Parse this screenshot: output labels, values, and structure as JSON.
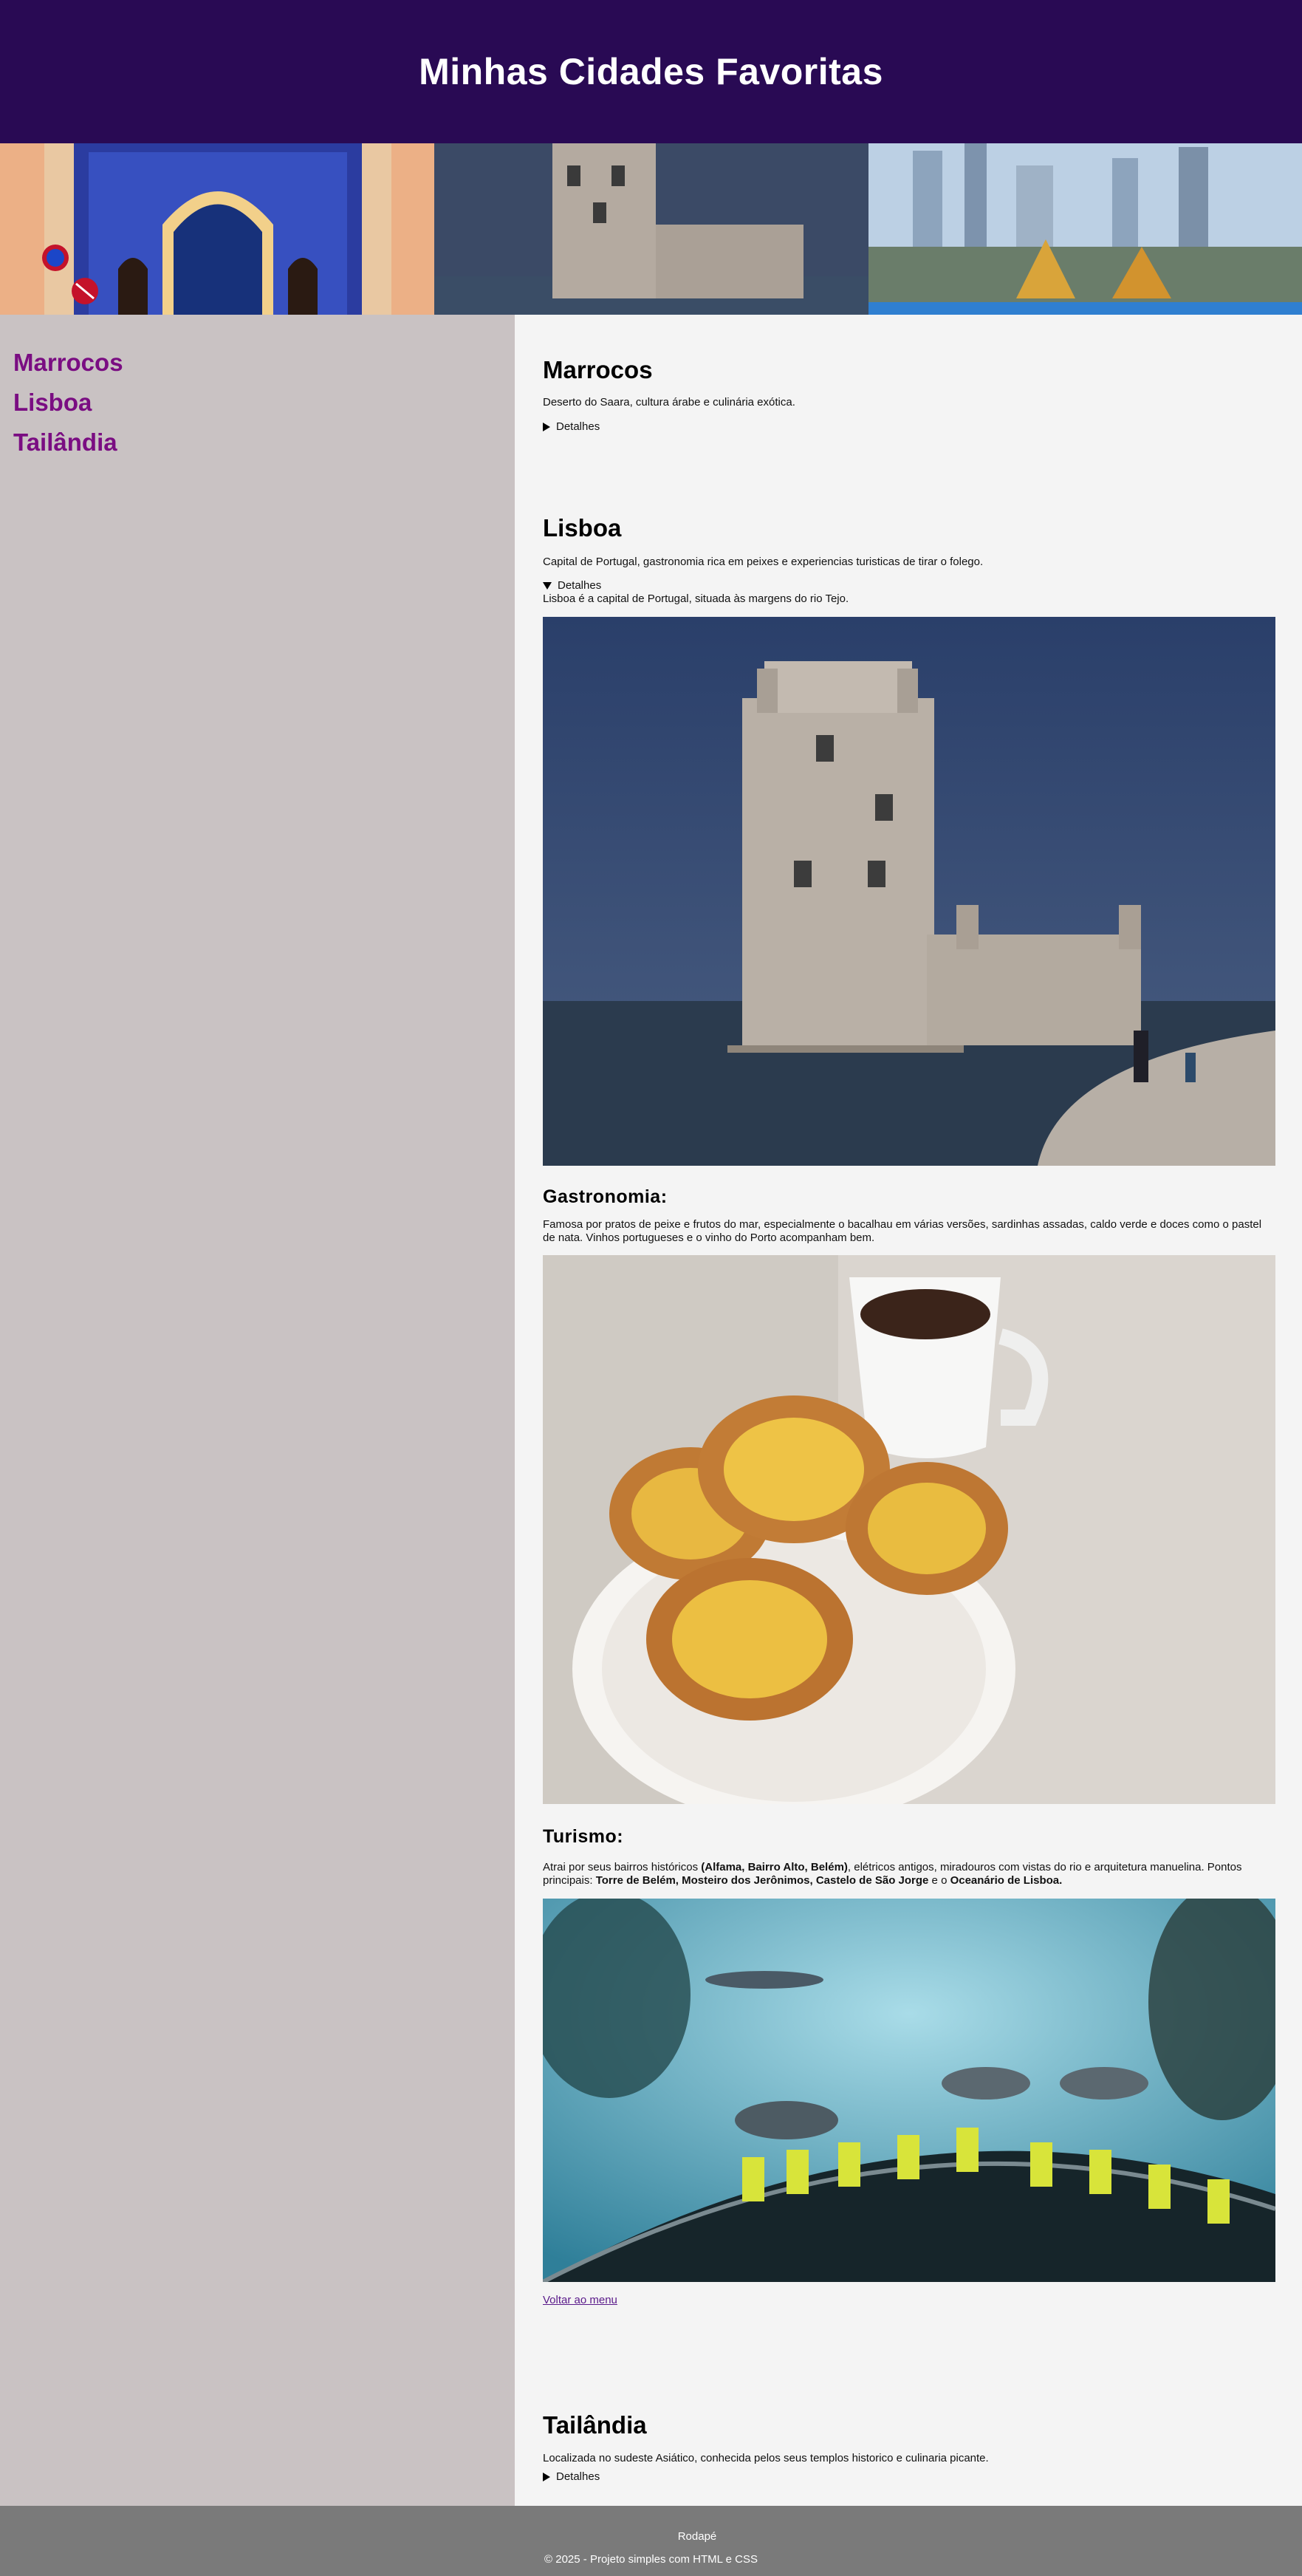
{
  "header": {
    "title": "Minhas Cidades Favoritas"
  },
  "banner": {
    "images": [
      "fez-blue-gate-image",
      "belem-tower-image",
      "bangkok-skyline-image"
    ]
  },
  "sidebar": {
    "items": [
      {
        "label": "Marrocos"
      },
      {
        "label": "Lisboa"
      },
      {
        "label": "Tailândia"
      }
    ]
  },
  "sections": {
    "marrocos": {
      "title": "Marrocos",
      "description": "Deserto do Saara, cultura árabe e culinária exótica.",
      "details_label": "Detalhes"
    },
    "lisboa": {
      "title": "Lisboa",
      "description": "Capital de Portugal, gastronomia rica em peixes e experiencias turisticas de tirar o folego.",
      "details_label": "Detalhes",
      "details_text": "Lisboa é a capital de Portugal, situada às margens do rio Tejo.",
      "gastronomia_title": "Gastronomia:",
      "gastronomia_text": "Famosa por pratos de peixe e frutos do mar, especialmente o bacalhau em várias versões, sardinhas assadas, caldo verde e doces como o pastel de nata. Vinhos portugueses e o vinho do Porto acompanham bem.",
      "turismo_title": "Turismo:",
      "turismo_p1": "Atrai por seus bairros históricos ",
      "turismo_b1": "(Alfama, Bairro Alto, Belém)",
      "turismo_p2": ", elétricos antigos, miradouros com vistas do rio e arquitetura manuelina. Pontos principais: ",
      "turismo_b2": "Torre de Belém, Mosteiro dos Jerônimos, Castelo de São Jorge",
      "turismo_p3": " e o ",
      "turismo_b3": "Oceanário de Lisboa.",
      "back_link": "Voltar ao menu"
    },
    "tailandia": {
      "title": "Tailândia",
      "description": "Localizada no sudeste Asiático, conhecida pelos seus templos historico e culinaria picante.",
      "details_label": "Detalhes"
    }
  },
  "footer": {
    "label": "Rodapé",
    "copyright": "© 2025 - Projeto simples com HTML e CSS"
  }
}
